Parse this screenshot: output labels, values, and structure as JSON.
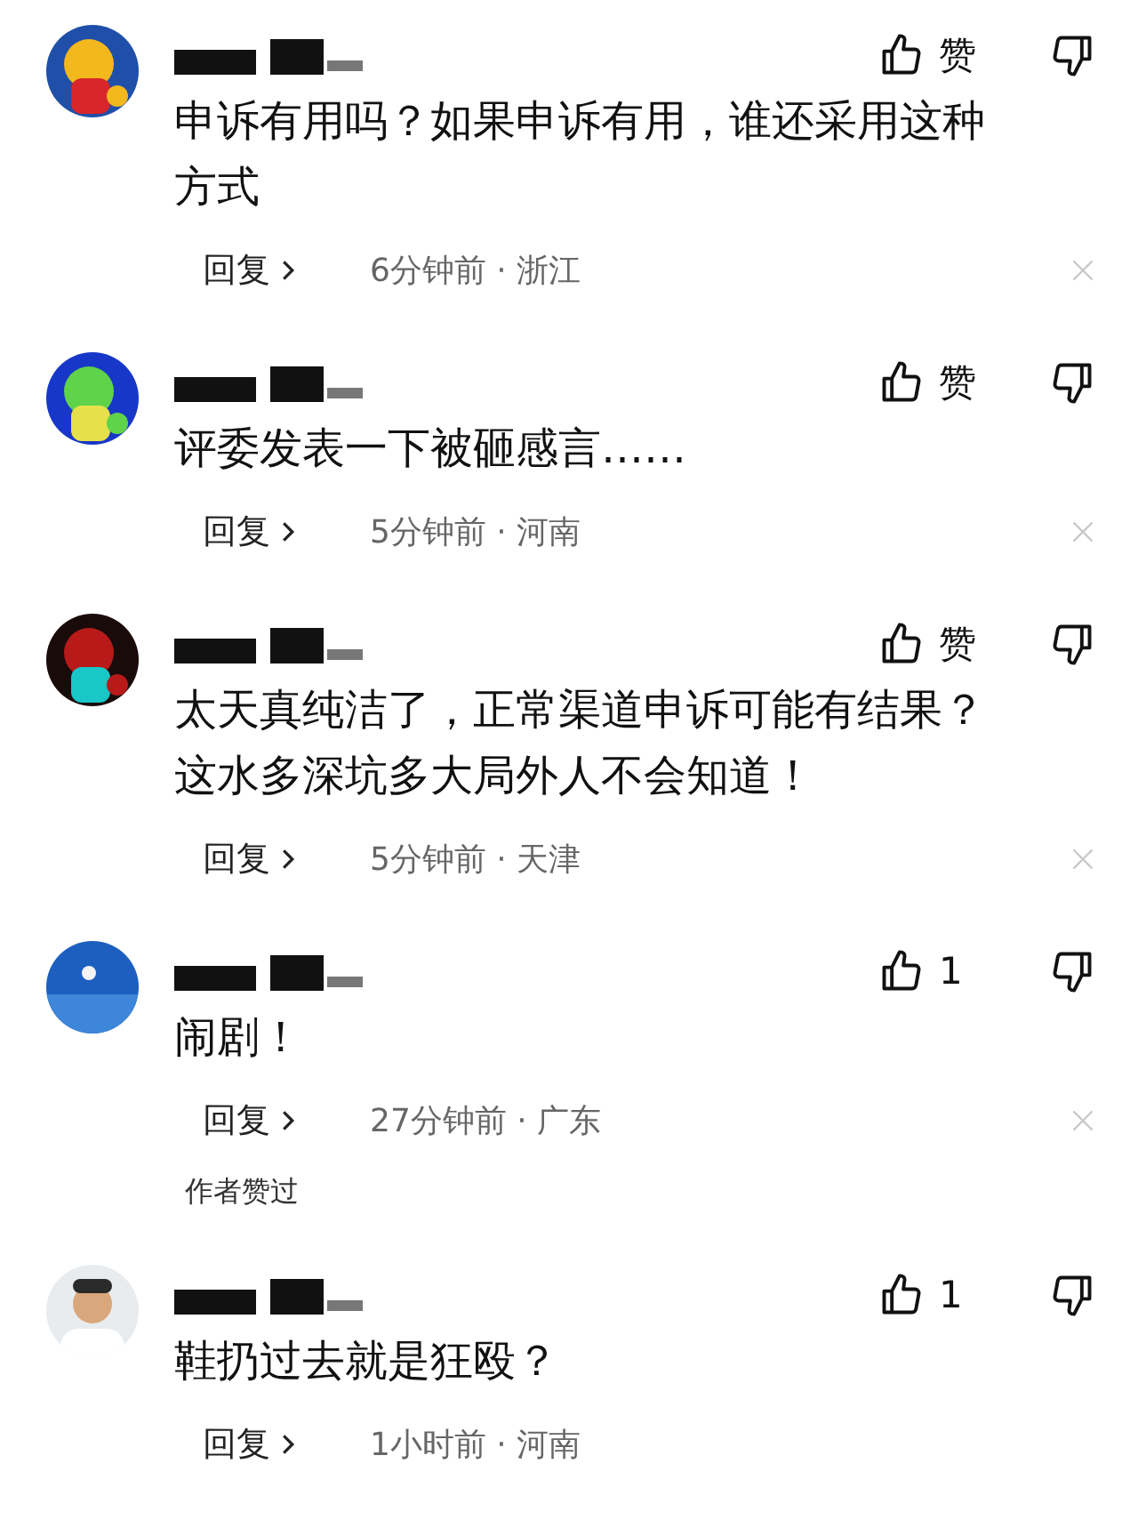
{
  "comments": [
    {
      "text": "申诉有用吗？如果申诉有用，谁还采用这种方式",
      "like_label": "赞",
      "reply": "回复",
      "meta": "6分钟前 · 浙江",
      "dismissible": true
    },
    {
      "text": "评委发表一下被砸感言……",
      "like_label": "赞",
      "reply": "回复",
      "meta": "5分钟前 · 河南",
      "dismissible": true
    },
    {
      "text": "太天真纯洁了，正常渠道申诉可能有结果？这水多深坑多大局外人不会知道！",
      "like_label": "赞",
      "reply": "回复",
      "meta": "5分钟前 · 天津",
      "dismissible": true
    },
    {
      "text": "闹剧！",
      "like_label": "1",
      "reply": "回复",
      "meta": "27分钟前 · 广东",
      "dismissible": true,
      "author_note": "作者赞过"
    },
    {
      "text": "鞋扔过去就是狂殴？",
      "like_label": "1",
      "reply": "回复",
      "meta": "1小时前 · 河南",
      "dismissible": false
    }
  ]
}
